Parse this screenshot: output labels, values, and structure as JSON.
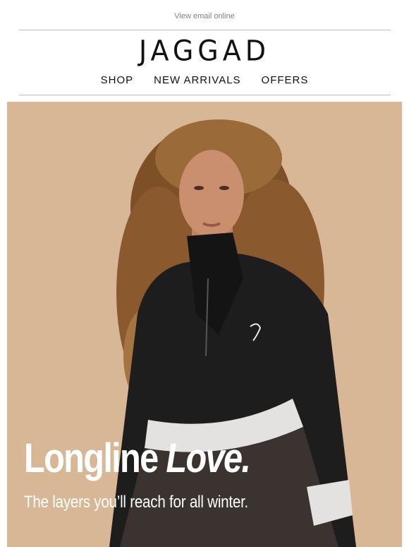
{
  "header": {
    "view_online": "View email online",
    "logo": "JAGGAD"
  },
  "nav": {
    "items": [
      {
        "label": "SHOP"
      },
      {
        "label": "NEW ARRIVALS"
      },
      {
        "label": "OFFERS"
      }
    ]
  },
  "hero": {
    "headline_a": "Longline ",
    "headline_b": "Love.",
    "subheadline": "The layers you’ll reach for all winter.",
    "image_subject": "woman-in-black-half-zip-sweatshirt",
    "colors": {
      "background": "#d7b796",
      "garment": "#1e1d1d",
      "stripe": "#e4e2e0",
      "lower_panel": "#3a3330",
      "hair": "#8a5a2e",
      "skin": "#c98f6e"
    }
  }
}
